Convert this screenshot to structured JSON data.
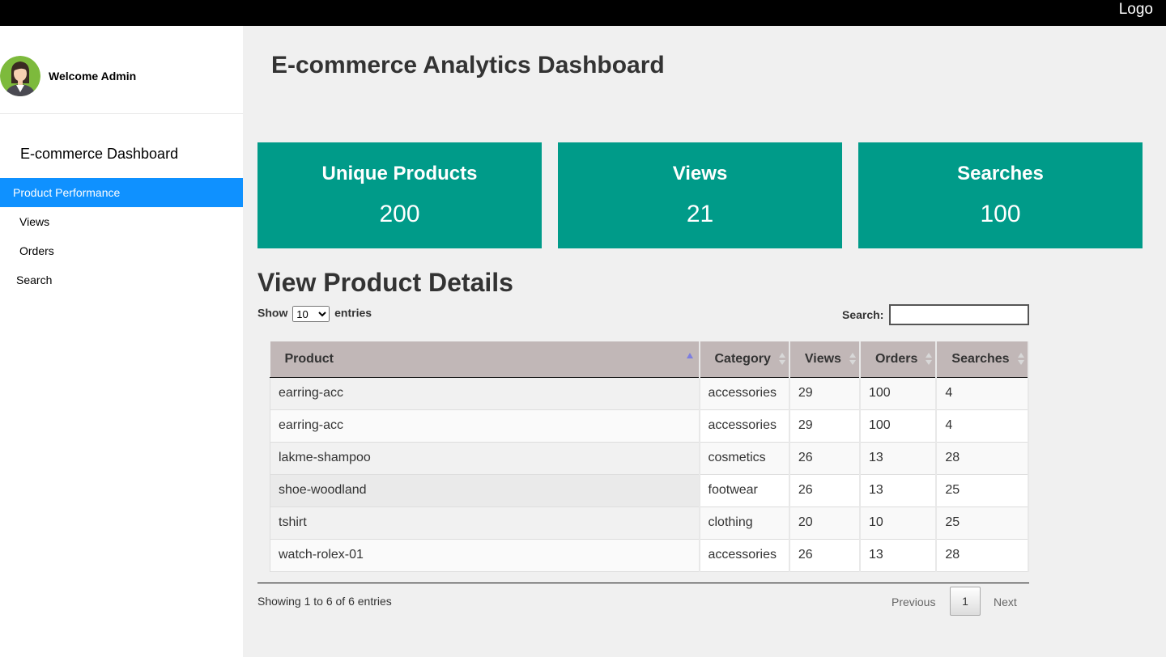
{
  "header": {
    "logo": "Logo"
  },
  "sidebar": {
    "welcome": "Welcome Admin",
    "title": "E-commerce Dashboard",
    "items": [
      {
        "label": "Product Performance",
        "active": true
      },
      {
        "label": "Views"
      },
      {
        "label": "Orders"
      },
      {
        "label": "Search"
      }
    ]
  },
  "main": {
    "title": "E-commerce Analytics Dashboard",
    "cards": [
      {
        "title": "Unique Products",
        "value": "200"
      },
      {
        "title": "Views",
        "value": "21"
      },
      {
        "title": "Searches",
        "value": "100"
      }
    ],
    "section_title": "View Product Details",
    "length_show": "Show",
    "length_entries": "entries",
    "length_value": "10",
    "length_options": [
      "10"
    ],
    "search_label": "Search:",
    "search_value": "",
    "table": {
      "columns": [
        "Product",
        "Category",
        "Views",
        "Orders",
        "Searches"
      ],
      "rows": [
        [
          "earring-acc",
          "accessories",
          "29",
          "100",
          "4"
        ],
        [
          "earring-acc",
          "accessories",
          "29",
          "100",
          "4"
        ],
        [
          "lakme-shampoo",
          "cosmetics",
          "26",
          "13",
          "28"
        ],
        [
          "shoe-woodland",
          "footwear",
          "26",
          "13",
          "25"
        ],
        [
          "tshirt",
          "clothing",
          "20",
          "10",
          "25"
        ],
        [
          "watch-rolex-01",
          "accessories",
          "26",
          "13",
          "28"
        ]
      ]
    },
    "info": "Showing 1 to 6 of 6 entries",
    "pagination": {
      "previous": "Previous",
      "current": "1",
      "next": "Next"
    }
  },
  "colors": {
    "card": "#009b89",
    "active_nav": "#0f91ff",
    "table_header": "#c1b7b7",
    "topbar": "#000000"
  }
}
